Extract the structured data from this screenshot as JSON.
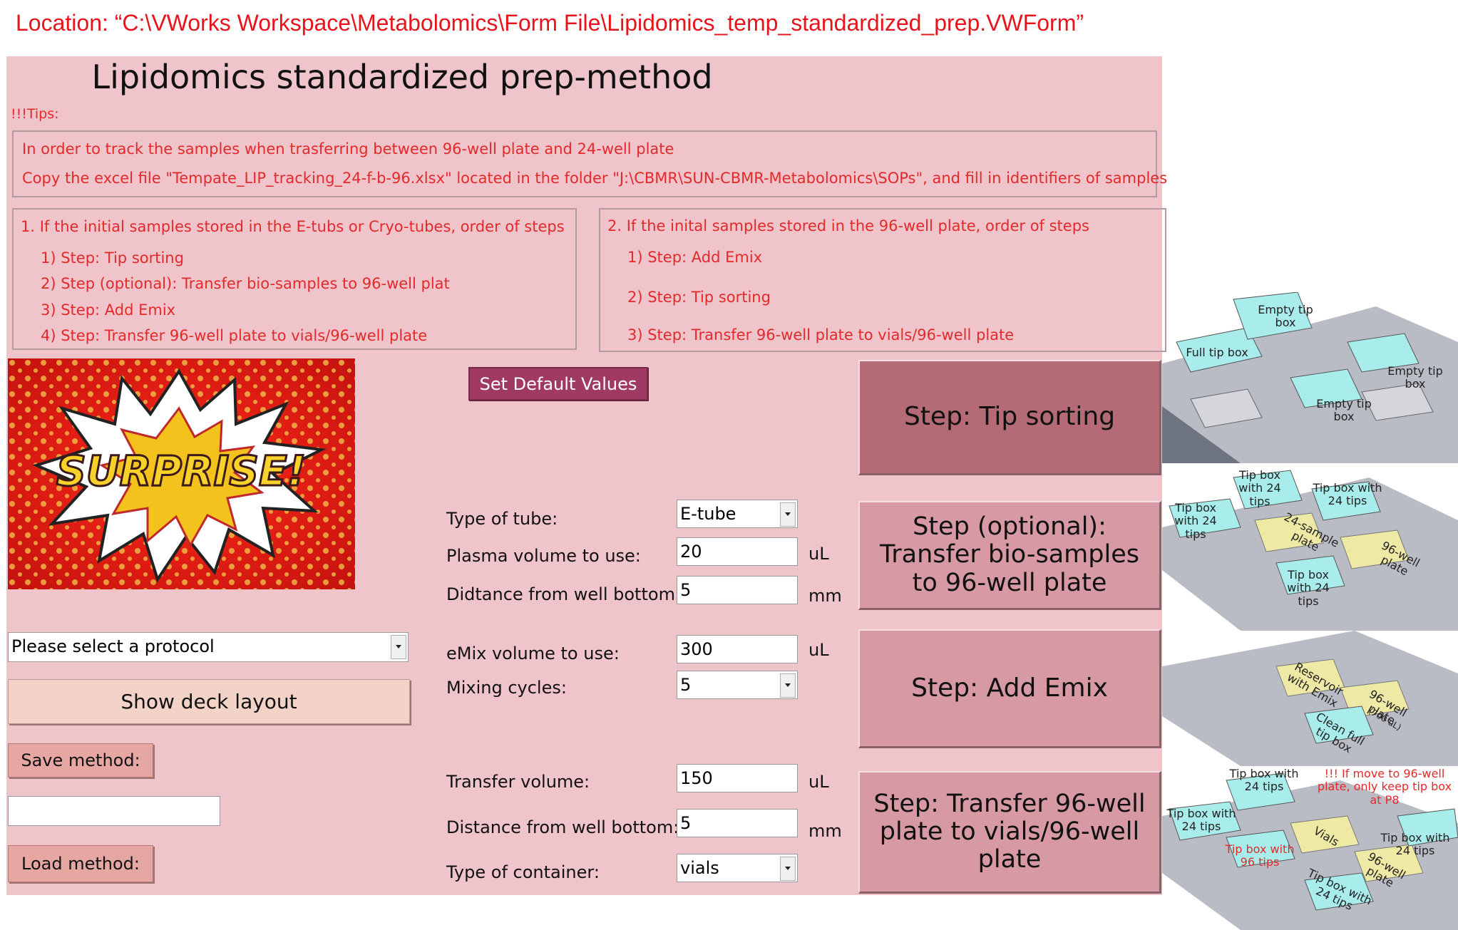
{
  "location_text": "Location: “C:\\VWorks Workspace\\Metabolomics\\Form File\\Lipidomics_temp_standardized_prep.VWForm”",
  "form": {
    "title": "Lipidomics standardized prep-method",
    "tips_label": "!!!Tips:",
    "tips_line1": "In order to track the samples when trasferring between 96-well plate and  24-well plate",
    "tips_line2": "Copy the excel file \"Tempate_LIP_tracking_24-f-b-96.xlsx\" located in the folder \"J:\\CBMR\\SUN-CBMR-Metabolomics\\SOPs\", and fill in identifiers of samples",
    "case1": {
      "heading": "1. If  the initial samples stored in the E-tubs or Cryo-tubes, order of steps",
      "steps": [
        "1) Step: Tip sorting",
        "2) Step (optional): Transfer bio-samples to 96-well plat",
        "3) Step: Add Emix",
        "4) Step: Transfer 96-well plate to vials/96-well plate"
      ]
    },
    "case2": {
      "heading": "2. If the inital samples stored  in the 96-well plate, order of steps",
      "steps": [
        "1) Step: Add Emix",
        "2) Step: Tip sorting",
        "3) Step: Transfer 96-well plate to vials/96-well plate"
      ]
    },
    "set_default_label": "Set Default Values",
    "surprise_text": "SURPRISE!",
    "protocol_select": "Please select a protocol",
    "show_deck_label": "Show deck layout",
    "save_method_label": "Save method:",
    "save_method_value": "",
    "load_method_label": "Load method:",
    "params": {
      "tube_type_label": "Type of tube:",
      "tube_type_value": "E-tube",
      "plasma_label": "Plasma volume to use:",
      "plasma_value": "20",
      "plasma_unit": "uL",
      "distance1_label": "Didtance from well bottom:",
      "distance1_value": "5",
      "distance1_unit": "mm",
      "emix_label": "eMix volume to use:",
      "emix_value": "300",
      "emix_unit": "uL",
      "mixing_label": "Mixing cycles:",
      "mixing_value": "5",
      "transfer_label": "Transfer volume:",
      "transfer_value": "150",
      "transfer_unit": "uL",
      "distance2_label": "Distance from well bottom:",
      "distance2_value": "5",
      "distance2_unit": "mm",
      "container_label": "Type of container:",
      "container_value": "vials"
    },
    "step_buttons": {
      "tip_sorting": "Step: Tip sorting",
      "transfer_bio": "Step (optional): Transfer bio-samples to 96-well plate",
      "add_emix": "Step: Add Emix",
      "transfer_96": "Step: Transfer 96-well plate to vials/96-well plate"
    }
  },
  "deck_images": {
    "deck1": {
      "labels": [
        "Empty tip box",
        "Full tip box",
        "Empty tip box",
        "Empty tip box"
      ]
    },
    "deck2": {
      "labels": [
        "Tip box with 24 tips",
        "Tip box with 24 tips",
        "Tip box with 24 tips",
        "24-sample plate",
        "96-well plate",
        "Tip box with 24 tips"
      ]
    },
    "deck3": {
      "labels": [
        "Reservoir with Emix",
        "96-well plate",
        "(700 uL)",
        "Clean full tip box"
      ]
    },
    "deck4": {
      "labels": [
        "Tip box with 24 tips",
        "!!! If move to 96-well plate, only keep tip box at P8",
        "Tip box with 24 tips",
        "Tip box with 96 tips",
        "Vials",
        "96-well plate",
        "Tip box with 24 tips",
        "Tip box with 24 tips"
      ]
    }
  },
  "colors": {
    "form_bg": "#efc4cb",
    "accent_red": "#e32a2a",
    "step_tip": "#b56b76",
    "step_other": "#d79aa4",
    "default_btn": "#a03a62"
  }
}
